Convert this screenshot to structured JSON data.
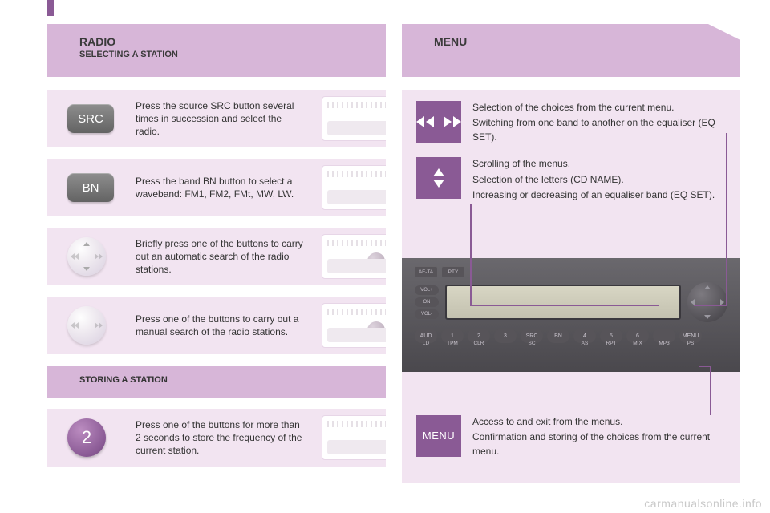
{
  "left": {
    "title": "RADIO",
    "subtitle": "SELECTING A STATION",
    "steps": [
      {
        "icon": "SRC",
        "text": "Press the source SRC button several times in succession and select the radio."
      },
      {
        "icon": "BN",
        "text": "Press the band BN button to select a waveband: FM1, FM2, FMt, MW, LW."
      },
      {
        "icon": "dial-vertical",
        "text": "Briefly press one of the buttons to carry out an automatic search of the radio stations."
      },
      {
        "icon": "dial-horizontal",
        "text": "Press one of the buttons to carry out a manual search of the radio stations."
      }
    ],
    "storing_title": "STORING A STATION",
    "storing_step": {
      "icon": "2",
      "text": "Press one of the buttons for more than 2 seconds to store the frequency of the current station."
    }
  },
  "right": {
    "title": "MENU",
    "callouts": {
      "lr": [
        "Selection of the choices from the current menu.",
        "Switching from one band to another on the equaliser (EQ SET)."
      ],
      "ud": [
        "Scrolling of the menus.",
        "Selection of the letters (CD NAME).",
        "Increasing or decreasing of an equaliser band (EQ SET)."
      ],
      "menu": [
        "Access to and exit from the menus.",
        "Confirmation and storing of the choices from the current menu."
      ],
      "menu_label": "MENU"
    },
    "radio": {
      "top_buttons": [
        "AF-TA",
        "PTY"
      ],
      "side_buttons": [
        "VOL+",
        "ON",
        "VOL-"
      ],
      "bottom_labels": [
        "LD",
        "TPM",
        "CLR",
        "",
        "SC",
        "",
        "AS",
        "RPT",
        "MIX",
        "MP3",
        "PS"
      ],
      "bottom_buttons": [
        "AUD",
        "1",
        "2",
        "3",
        "SRC",
        "BN",
        "4",
        "5",
        "6",
        "",
        "MENU"
      ]
    }
  },
  "watermark": "carmanualsonline.info"
}
